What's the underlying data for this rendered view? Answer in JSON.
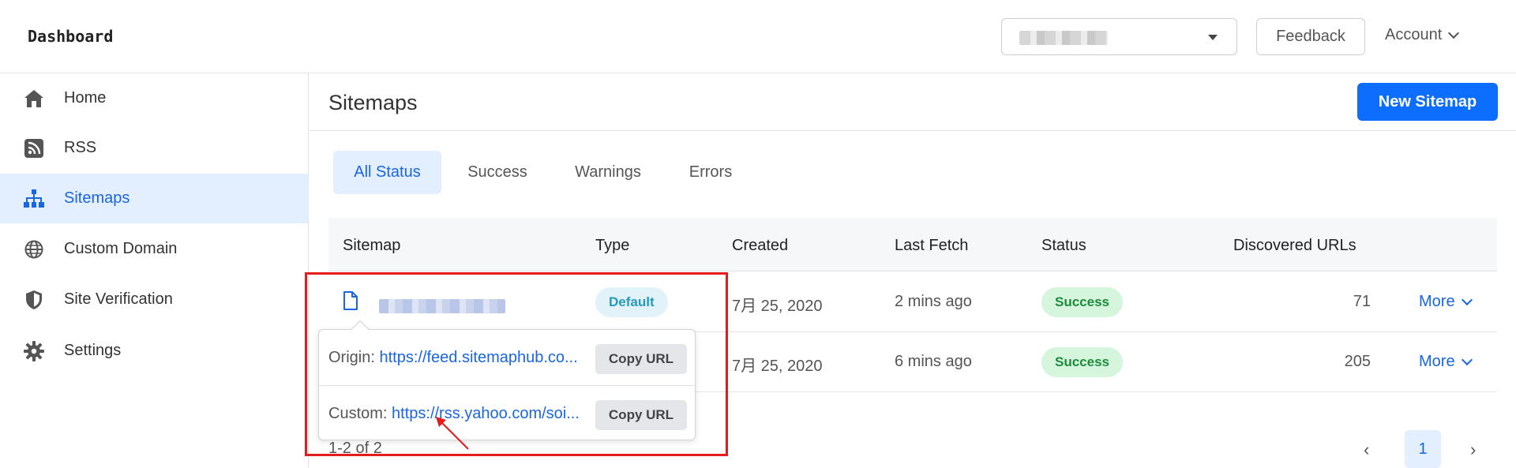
{
  "header": {
    "brand": "Dashboard",
    "feedback_label": "Feedback",
    "account_label": "Account"
  },
  "sidebar": {
    "items": [
      {
        "label": "Home",
        "icon": "home-icon"
      },
      {
        "label": "RSS",
        "icon": "rss-icon"
      },
      {
        "label": "Sitemaps",
        "icon": "sitemap-icon",
        "active": true
      },
      {
        "label": "Custom Domain",
        "icon": "globe-icon"
      },
      {
        "label": "Site Verification",
        "icon": "shield-icon"
      },
      {
        "label": "Settings",
        "icon": "gear-icon"
      }
    ]
  },
  "main": {
    "title": "Sitemaps",
    "new_button": "New Sitemap",
    "tabs": [
      {
        "label": "All Status",
        "active": true
      },
      {
        "label": "Success"
      },
      {
        "label": "Warnings"
      },
      {
        "label": "Errors"
      }
    ],
    "columns": [
      "Sitemap",
      "Type",
      "Created",
      "Last Fetch",
      "Status",
      "Discovered URLs"
    ],
    "rows": [
      {
        "type": "Default",
        "created": "7月 25, 2020",
        "last_fetch": "2 mins ago",
        "status": "Success",
        "urls": "71",
        "more": "More"
      },
      {
        "type": "",
        "created": "7月 25, 2020",
        "last_fetch": "6 mins ago",
        "status": "Success",
        "urls": "205",
        "more": "More"
      }
    ],
    "pager": {
      "info": "1-2 of 2",
      "page": "1"
    }
  },
  "popover": {
    "origin_label": "Origin:",
    "origin_url": "https://feed.sitemaphub.co...",
    "custom_label": "Custom:",
    "custom_url": "https://rss.yahoo.com/soi...",
    "copy_label": "Copy URL"
  },
  "colors": {
    "accent": "#1a66e0",
    "primary_button": "#0d6efd",
    "active_bg": "#e3efff",
    "annotation": "#e51c1c"
  }
}
